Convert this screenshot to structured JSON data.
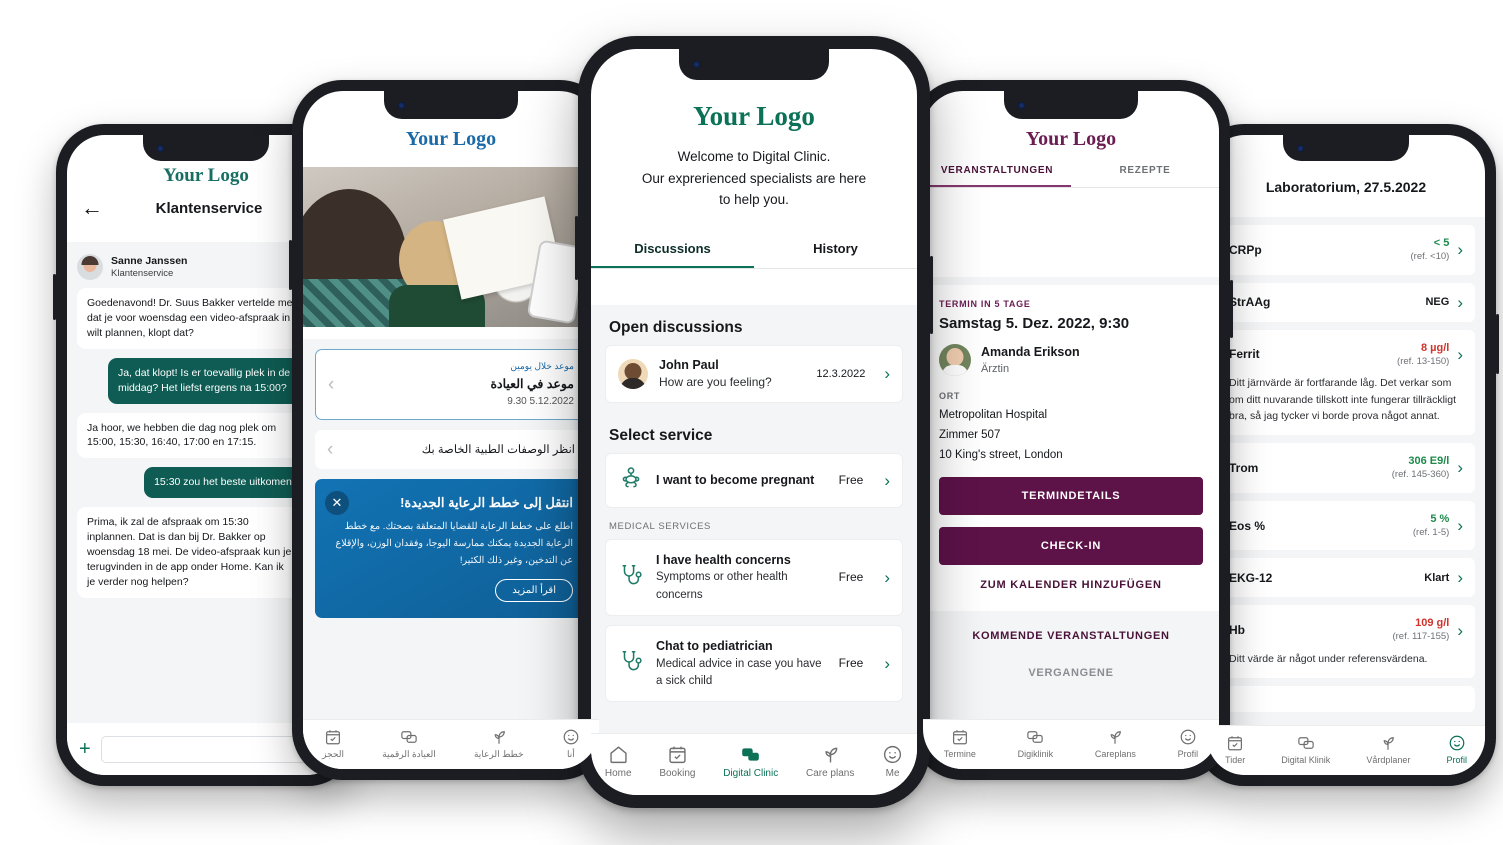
{
  "phone1": {
    "logo": "Your Logo",
    "back_icon": "arrow-left-icon",
    "title": "Klantenservice",
    "sender_name": "Sanne Janssen",
    "sender_role": "Klantenservice",
    "messages": [
      {
        "from": "them",
        "text": "Goedenavond! Dr. Suus Bakker vertelde me dat je voor woensdag een video-afspraak in wilt plannen, klopt dat?"
      },
      {
        "from": "me",
        "text": "Ja, dat klopt! Is er toevallig plek in de middag? Het liefst ergens na 15:00?"
      },
      {
        "from": "them",
        "text": "Ja hoor, we hebben die dag nog plek om 15:00, 15:30, 16:40, 17:00 en 17:15."
      },
      {
        "from": "me",
        "text": "15:30 zou het beste uitkomen"
      },
      {
        "from": "them",
        "text": "Prima, ik zal de afspraak om 15:30 inplannen. Dat is dan bij Dr. Bakker op woensdag 18 mei. De video-afspraak kun je terugvinden in de app onder Home. Kan ik je verder nog helpen?"
      }
    ],
    "compose_placeholder": "",
    "plus_label": "+"
  },
  "phone2": {
    "logo": "Your Logo",
    "cards": [
      {
        "kicker": "موعد خلال يومين",
        "title": "موعد في العيادة",
        "date": "5.12.2022 9.30"
      }
    ],
    "link_row": "انظر الوصفات الطبية الخاصة بك",
    "promo": {
      "title": "انتقل إلى خطط الرعاية الجديدة!",
      "body": "اطلع على خطط الرعاية للقضايا المتعلقة بصحتك. مع خطط الرعاية الجديدة يمكنك ممارسة اليوجا، وفقدان الوزن، والإقلاع عن التدخين، وغير ذلك الكثير!",
      "button": "اقرأ المزيد",
      "close_icon": "close-icon"
    },
    "tabs": [
      {
        "label": "الحجز",
        "icon": "calendar-check-icon",
        "active": false
      },
      {
        "label": "العيادة الرقمية",
        "icon": "chat-bubbles-icon",
        "active": false
      },
      {
        "label": "خطط الرعاية",
        "icon": "sprout-icon",
        "active": false
      },
      {
        "label": "أنا",
        "icon": "smiley-icon",
        "active": false
      }
    ]
  },
  "phone3": {
    "logo": "Your Logo",
    "welcome_line1": "Welcome to Digital Clinic.",
    "welcome_line2": "Our exprerienced specialists are here",
    "welcome_line3": "to help you.",
    "tabs": [
      {
        "label": "Discussions",
        "active": true
      },
      {
        "label": "History",
        "active": false
      }
    ],
    "open_discussions_heading": "Open discussions",
    "discussion": {
      "name": "John Paul",
      "preview": "How are you feeling?",
      "date": "12.3.2022",
      "chevron": "chevron-right-icon"
    },
    "select_service_heading": "Select service",
    "featured_service": {
      "title": "I want to become pregnant",
      "price": "Free",
      "icon": "baby-icon"
    },
    "medical_services_label": "MEDICAL SERVICES",
    "services": [
      {
        "title": "I have health concerns",
        "subtitle": "Symptoms or other health concerns",
        "price": "Free",
        "icon": "stethoscope-icon"
      },
      {
        "title": "Chat to pediatrician",
        "subtitle": "Medical advice in case you have a sick child",
        "price": "Free",
        "icon": "stethoscope-icon"
      }
    ],
    "tabs_bottom": [
      {
        "label": "Home",
        "icon": "home-icon",
        "active": false
      },
      {
        "label": "Booking",
        "icon": "calendar-check-icon",
        "active": false
      },
      {
        "label": "Digital Clinic",
        "icon": "chat-bubbles-icon",
        "active": true
      },
      {
        "label": "Care plans",
        "icon": "sprout-icon",
        "active": false
      },
      {
        "label": "Me",
        "icon": "smiley-icon",
        "active": false
      }
    ],
    "accent_color": "#0b7157"
  },
  "phone4": {
    "logo": "Your Logo",
    "tabs": [
      {
        "label": "VERANSTALTUNGEN",
        "active": true
      },
      {
        "label": "REZEPTE",
        "active": false
      }
    ],
    "appointment": {
      "kicker": "TERMIN IN 5 TAGE",
      "date": "Samstag 5. Dez. 2022, 9:30",
      "doctor_name": "Amanda Erikson",
      "doctor_role": "Ärztin",
      "place_label": "ORT",
      "place_line1": "Metropolitan Hospital",
      "place_line2": "Zimmer 507",
      "place_line3": "10 King's street, London",
      "button_primary": "TERMINDETAILS",
      "button_secondary": "CHECK-IN",
      "link": "ZUM KALENDER HINZUFÜGEN"
    },
    "upcoming_label": "KOMMENDE VERANSTALTUNGEN",
    "past_label": "VERGANGENE",
    "tabs_bottom": [
      {
        "label": "Termine",
        "icon": "calendar-check-icon",
        "active": false
      },
      {
        "label": "Digiklinik",
        "icon": "chat-bubbles-icon",
        "active": false
      },
      {
        "label": "Careplans",
        "icon": "sprout-icon",
        "active": false
      },
      {
        "label": "Profil",
        "icon": "smiley-icon",
        "active": false
      }
    ],
    "accent_color": "#6b1d52"
  },
  "phone5": {
    "title": "Laboratorium, 27.5.2022",
    "results": [
      {
        "label": "CRPp",
        "value": "< 5",
        "ref": "(ref. <10)",
        "status": "normal",
        "note": ""
      },
      {
        "label": "StrAAg",
        "value": "NEG",
        "ref": "",
        "status": "plain",
        "note": ""
      },
      {
        "label": "Ferrit",
        "value": "8 µg/l",
        "ref": "(ref. 13-150)",
        "status": "high",
        "note": "Ditt järnvärde är fortfarande låg. Det verkar som om ditt nuvarande tillskott inte fungerar tillräckligt bra, så jag tycker vi borde prova något annat."
      },
      {
        "label": "Trom",
        "value": "306 E9/l",
        "ref": "(ref. 145-360)",
        "status": "normal",
        "note": ""
      },
      {
        "label": "Eos %",
        "value": "5 %",
        "ref": "(ref. 1-5)",
        "status": "normal",
        "note": ""
      },
      {
        "label": "EKG-12",
        "value": "Klart",
        "ref": "",
        "status": "plain",
        "note": ""
      },
      {
        "label": "Hb",
        "value": "109 g/l",
        "ref": "(ref. 117-155)",
        "status": "high",
        "note": "Ditt värde är något under referensvärdena."
      }
    ],
    "tabs_bottom": [
      {
        "label": "Tider",
        "icon": "calendar-check-icon",
        "active": false
      },
      {
        "label": "Digital Klinik",
        "icon": "chat-bubbles-icon",
        "active": false
      },
      {
        "label": "Vårdplaner",
        "icon": "sprout-icon",
        "active": false
      },
      {
        "label": "Profil",
        "icon": "smiley-icon",
        "active": true
      }
    ],
    "color_normal": "#1f8a4c",
    "color_high": "#d0342c"
  }
}
